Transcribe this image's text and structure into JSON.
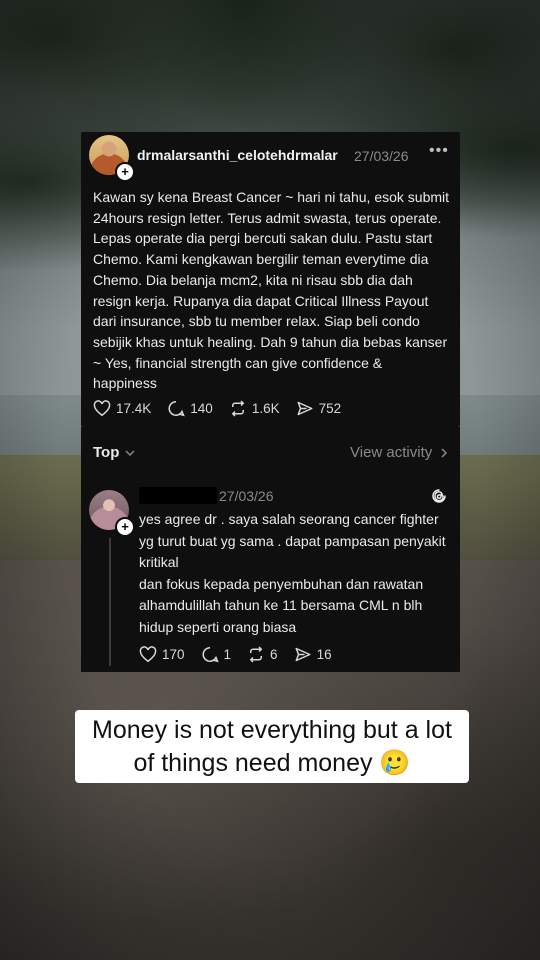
{
  "post": {
    "username": "drmalarsanthi_celotehdrmalar",
    "date": "27/03/26",
    "more_label": "•••",
    "body": "Kawan sy kena Breast Cancer ~ hari ni tahu, esok submit 24hours resign letter. Terus admit swasta, terus operate. Lepas operate dia pergi bercuti sakan dulu. Pastu start Chemo. Kami kengkawan bergilir teman everytime dia Chemo. Dia belanja mcm2, kita ni risau sbb dia dah resign kerja. Rupanya dia dapat Critical Illness Payout dari insurance, sbb tu member relax. Siap beli condo sebijik khas untuk healing. Dah 9 tahun dia bebas kanser ~ Yes, financial strength can give confidence & happiness",
    "likes": "17.4K",
    "comments": "140",
    "reposts": "1.6K",
    "shares": "752"
  },
  "sort": {
    "label": "Top",
    "view_activity": "View activity"
  },
  "reply": {
    "date": "27/03/26",
    "body": "yes agree dr . saya salah seorang cancer fighter yg turut buat yg sama . dapat pampasan penyakit kritikal\ndan fokus kepada penyembuhan dan rawatan alhamdulillah tahun ke 11 bersama CML n blh hidup seperti orang biasa",
    "likes": "170",
    "comments": "1",
    "reposts": "6",
    "shares": "16"
  },
  "caption": {
    "text": "Money is not everything but a lot of things need money 🥲"
  },
  "icons": {
    "like": "heart-icon",
    "comment": "comment-bubble-icon",
    "repost": "repost-icon",
    "share": "send-icon",
    "threads": "threads-logo-icon"
  },
  "colors": {
    "card_bg": "#0f0f0f",
    "text": "#eaeaea",
    "muted": "#8a8a8a"
  }
}
